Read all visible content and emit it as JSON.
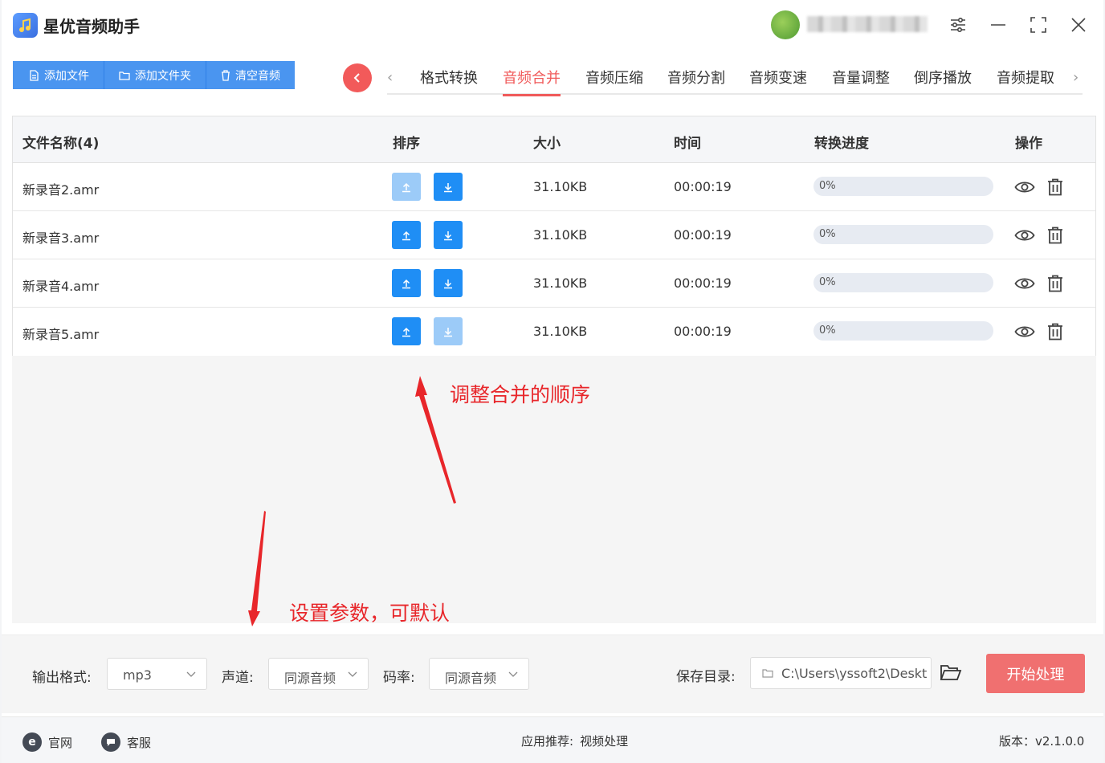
{
  "app": {
    "title": "星优音频助手",
    "username": "...",
    "icons": [
      "app-logo",
      "settings-sliders-icon",
      "minimize-icon",
      "maximize-icon",
      "close-icon"
    ]
  },
  "toolbar": {
    "add_file": "添加文件",
    "add_folder": "添加文件夹",
    "clear_audio": "清空音频",
    "accent": "#4a95f0"
  },
  "tabs": {
    "items": [
      "格式转换",
      "音频合并",
      "音频压缩",
      "音频分割",
      "音频变速",
      "音量调整",
      "倒序播放",
      "音频提取"
    ],
    "active": "音频合并",
    "active_color": "#f05a5a"
  },
  "table": {
    "headers": {
      "name": "文件名称(4)",
      "sort": "排序",
      "size": "大小",
      "time": "时间",
      "progress": "转换进度",
      "actions": "操作"
    },
    "rows": [
      {
        "name": "新录音2.amr",
        "size": "31.10KB",
        "time": "00:00:19",
        "progress": "0%",
        "progress_value": 0,
        "up_enabled": false,
        "down_enabled": true
      },
      {
        "name": "新录音3.amr",
        "size": "31.10KB",
        "time": "00:00:19",
        "progress": "0%",
        "progress_value": 0,
        "up_enabled": true,
        "down_enabled": true
      },
      {
        "name": "新录音4.amr",
        "size": "31.10KB",
        "time": "00:00:19",
        "progress": "0%",
        "progress_value": 0,
        "up_enabled": true,
        "down_enabled": true
      },
      {
        "name": "新录音5.amr",
        "size": "31.10KB",
        "time": "00:00:19",
        "progress": "0%",
        "progress_value": 0,
        "up_enabled": true,
        "down_enabled": false
      }
    ]
  },
  "annotations": {
    "order_hint": "调整合并的顺序",
    "params_hint": "设置参数，可默认",
    "color": "#e8262a"
  },
  "settings": {
    "format_label": "输出格式:",
    "format_value": "mp3",
    "channel_label": "声道:",
    "channel_value": "同源音频",
    "bitrate_label": "码率:",
    "bitrate_value": "同源音频",
    "save_label": "保存目录:",
    "save_path": "C:\\Users\\yssoft2\\Deskt",
    "start_button": "开始处理",
    "start_color": "#f07070"
  },
  "statusbar": {
    "website": "官网",
    "support": "客服",
    "recommend_label": "应用推荐:",
    "recommend_link": "视频处理",
    "version": "版本：v2.1.0.0"
  }
}
